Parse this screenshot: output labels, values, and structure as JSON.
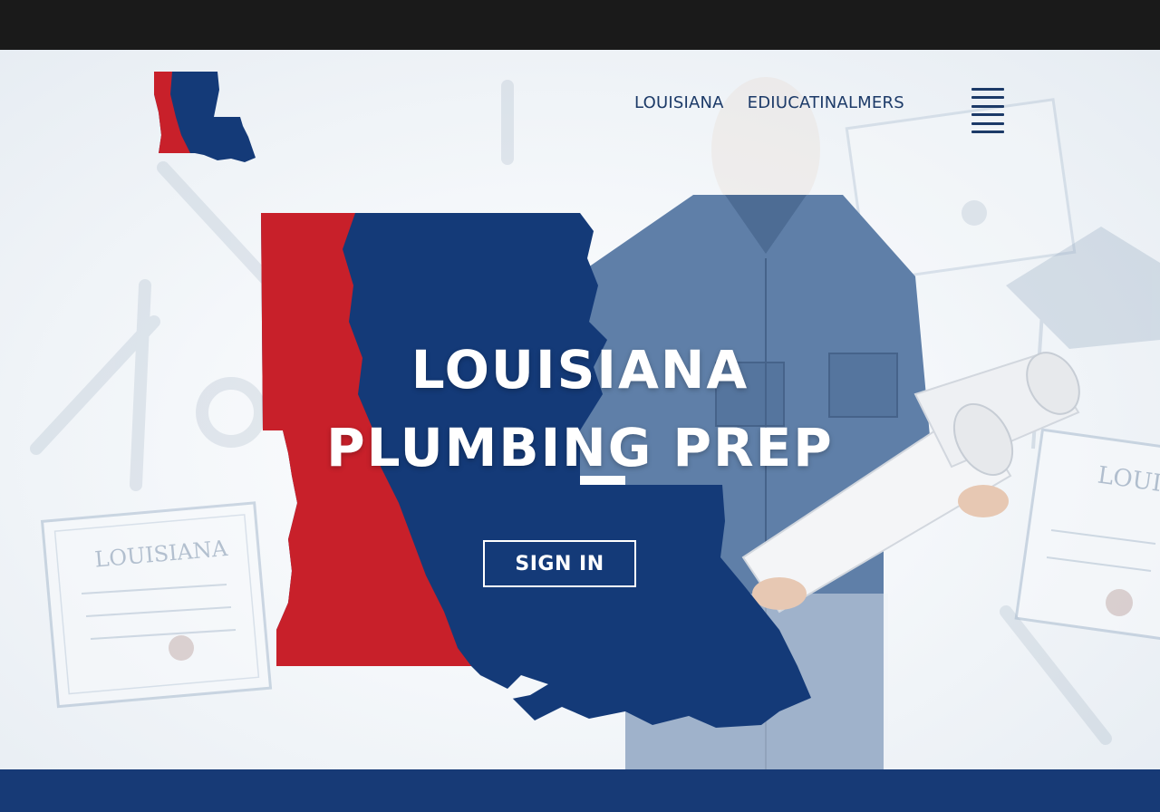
{
  "header": {
    "nav": [
      {
        "label": "LOUISIANA"
      },
      {
        "label": "EDIUCATINALMERS"
      }
    ]
  },
  "hero": {
    "title_line1": "LOUISIANA",
    "title_line2": "PLUMBING PREP",
    "signin_label": "SIGN IN"
  },
  "background": {
    "certificate_left_title": "LOUISIANA",
    "certificate_right_title": "LOUIS"
  },
  "colors": {
    "red": "#c8202a",
    "navy": "#143a78",
    "topbar": "#1a1a1a",
    "footer": "#173a76",
    "nav_text": "#1c3a68"
  },
  "icons": [
    "louisiana-logo-icon",
    "menu-icon",
    "wrench-icon",
    "certificate-icon",
    "graduation-cap-icon"
  ]
}
